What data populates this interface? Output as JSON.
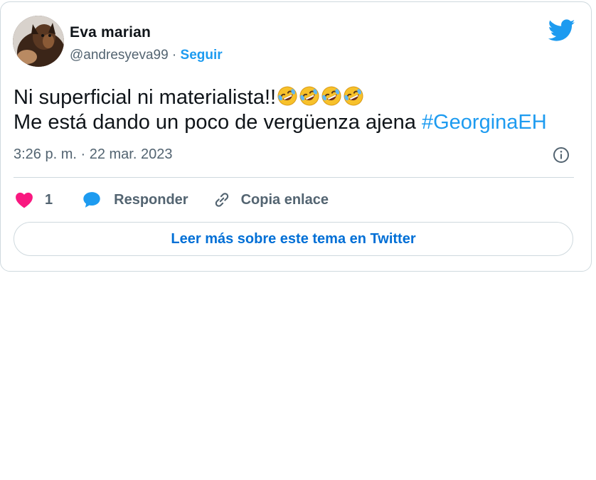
{
  "tweet": {
    "author_name": "Eva marian",
    "author_handle": "@andresyeva99",
    "separator": " · ",
    "follow_label": "Seguir",
    "text_line1": "Ni superficial ni materialista!!",
    "text_line2_prefix": "Me está dando un poco de vergüenza ajena ",
    "hashtag": "#GeorginaEH",
    "emoji_count": 4,
    "emoji_name": "rolling-on-floor-laughing-emoji",
    "timestamp": "3:26 p. m. · 22 mar. 2023",
    "like_count": "1",
    "reply_label": "Responder",
    "copy_link_label": "Copia enlace",
    "read_more_label": "Leer más sobre este tema en Twitter"
  },
  "icons": {
    "brand": "twitter-bird-icon",
    "info": "info-icon",
    "like": "heart-icon",
    "reply": "speech-bubble-icon",
    "copy": "link-icon"
  },
  "colors": {
    "accent": "#1d9bf0",
    "link_button_text": "#006fd6",
    "heart": "#f91880",
    "text_primary": "#0f1419",
    "text_secondary": "#536471",
    "border": "#cfd9de"
  }
}
